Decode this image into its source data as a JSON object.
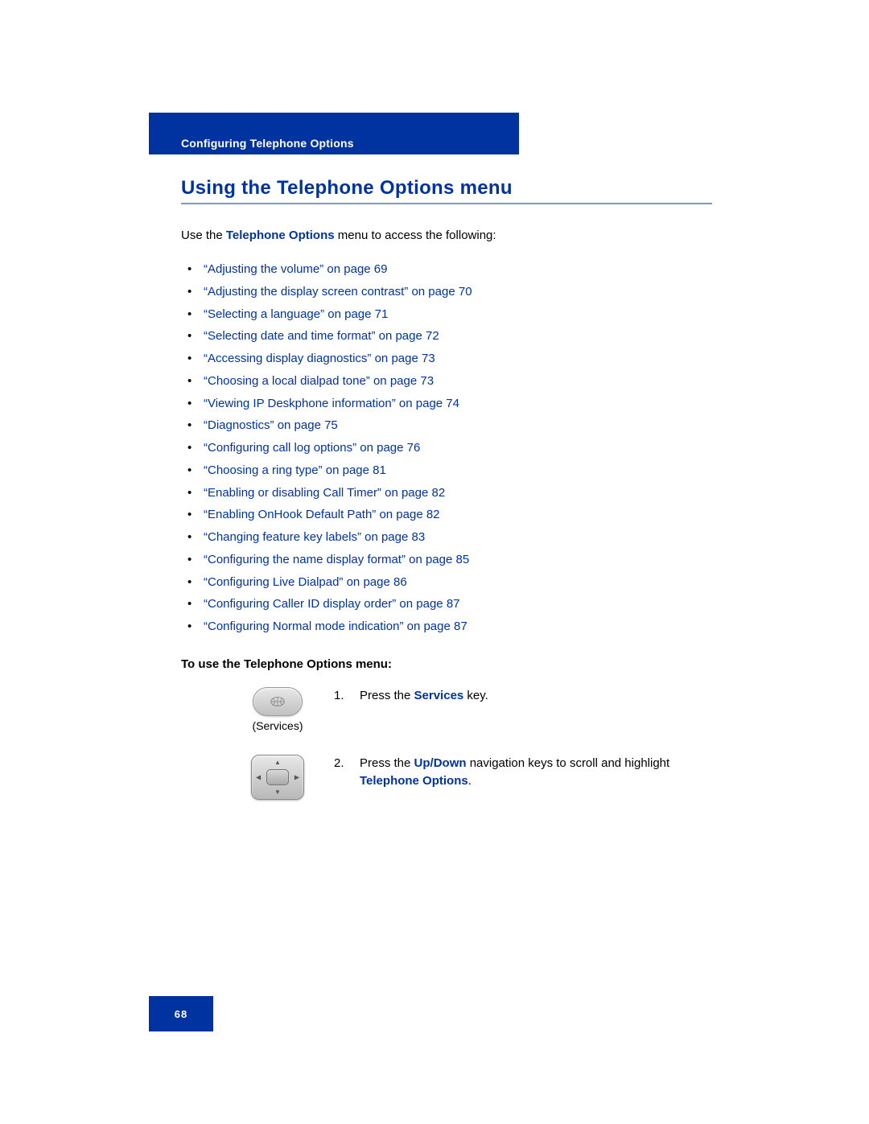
{
  "banner": {
    "title": "Configuring Telephone Options"
  },
  "heading": "Using the Telephone Options menu",
  "intro": {
    "prefix": "Use the ",
    "bold": "Telephone Options",
    "suffix": " menu to access the following:"
  },
  "links": [
    "“Adjusting the volume” on page 69",
    "“Adjusting the display screen contrast” on page 70",
    "“Selecting a language” on page 71",
    "“Selecting date and time format” on page 72",
    "“Accessing display diagnostics” on page 73",
    "“Choosing a local dialpad tone” on page 73",
    "“Viewing IP Deskphone information” on page 74",
    "“Diagnostics” on page 75",
    "“Configuring call log options” on page 76",
    "“Choosing a ring type” on page 81",
    "“Enabling or disabling Call Timer” on page 82",
    "“Enabling OnHook Default Path” on page 82",
    "“Changing feature key labels” on page 83",
    "“Configuring the name display format” on page 85",
    "“Configuring Live Dialpad” on page 86",
    "“Configuring Caller ID display order” on page 87",
    "“Configuring Normal mode indication” on page 87"
  ],
  "subhead": "To use the Telephone Options menu:",
  "step1": {
    "key_label": "(Services)",
    "num": "1.",
    "t1": "Press the ",
    "bold": "Services",
    "t2": " key."
  },
  "step2": {
    "num": "2.",
    "t1": "Press the ",
    "bold1": "Up/Down",
    "t2": " navigation keys to scroll and highlight ",
    "bold2": "Telephone Options",
    "t3": "."
  },
  "page_number": "68"
}
